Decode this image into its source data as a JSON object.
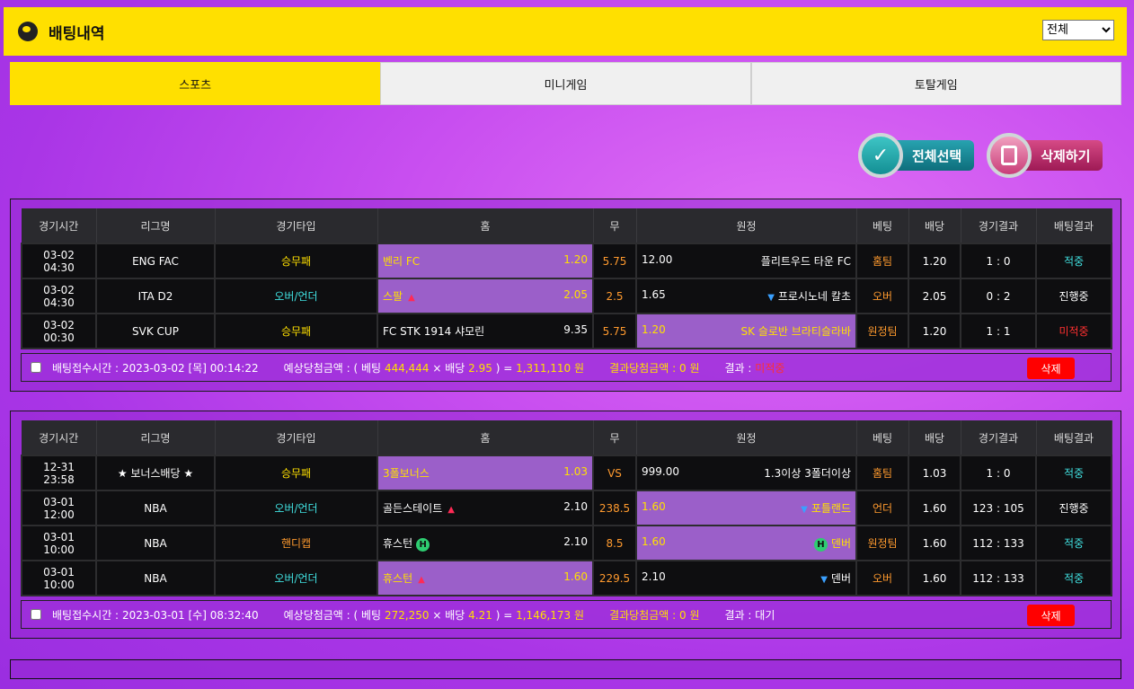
{
  "header": {
    "title": "배팅내역",
    "filter_selected": "전체",
    "filter_options": [
      "전체"
    ]
  },
  "tabs": [
    {
      "label": "스포츠"
    },
    {
      "label": "미니게임"
    },
    {
      "label": "토탈게임"
    }
  ],
  "actions": {
    "select_all": "전체선택",
    "delete": "삭제하기"
  },
  "columns": [
    "경기시간",
    "리그명",
    "경기타입",
    "홈",
    "무",
    "원정",
    "베팅",
    "배당",
    "경기결과",
    "배팅결과"
  ],
  "bets": [
    {
      "rows": [
        {
          "time": "03-02 04:30",
          "league": "ENG FAC",
          "type": "승무패",
          "home": "벤리 FC",
          "home_odds": "1.20",
          "draw": "5.75",
          "away_odds": "12.00",
          "away": "플리트우드 타운 FC",
          "pick": "홈팀",
          "odds": "1.20",
          "score": "1 : 0",
          "result": "적중"
        },
        {
          "time": "03-02 04:30",
          "league": "ITA D2",
          "type": "오버/언더",
          "home": "스팔",
          "home_odds": "2.05",
          "draw": "2.5",
          "away_odds": "1.65",
          "away": "프로시노네 칼초",
          "pick": "오버",
          "odds": "2.05",
          "score": "0 : 2",
          "result": "진행중"
        },
        {
          "time": "03-02 00:30",
          "league": "SVK CUP",
          "type": "승무패",
          "home": "FC STK 1914 샤모린",
          "home_odds": "9.35",
          "draw": "5.75",
          "away_odds": "1.20",
          "away": "SK 슬로반 브라티슬라바",
          "pick": "원정팀",
          "odds": "1.20",
          "score": "1 : 1",
          "result": "미적중"
        }
      ],
      "summary": {
        "accept_label": "배팅접수시간 :",
        "accept_time": "2023-03-02 [목] 00:14:22",
        "expected_label": "예상당첨금액 : ( 베팅",
        "bet_amount": "444,444",
        "mult": "× 배당",
        "bet_odds": "2.95",
        "eq": ") =",
        "payout": "1,311,110",
        "won": "원",
        "won_label": "결과당첨금액 :",
        "won_amount": "0",
        "won_unit": "원",
        "result_label": "결과 :",
        "result": "미적중",
        "delete": "삭제"
      }
    },
    {
      "rows": [
        {
          "time": "12-31 23:58",
          "league": "★ 보너스배당 ★",
          "type": "승무패",
          "home": "3폴보너스",
          "home_odds": "1.03",
          "draw": "VS",
          "away_odds": "999.00",
          "away": "1.3이상 3폴더이상",
          "pick": "홈팀",
          "odds": "1.03",
          "score": "1 : 0",
          "result": "적중"
        },
        {
          "time": "03-01 12:00",
          "league": "NBA",
          "type": "오버/언더",
          "home": "골든스테이트",
          "home_odds": "2.10",
          "draw": "238.5",
          "away_odds": "1.60",
          "away": "포틀랜드",
          "pick": "언더",
          "odds": "1.60",
          "score": "123 : 105",
          "result": "진행중"
        },
        {
          "time": "03-01 10:00",
          "league": "NBA",
          "type": "핸디캡",
          "home": "휴스턴",
          "home_odds": "2.10",
          "draw": "8.5",
          "away_odds": "1.60",
          "away": "덴버",
          "pick": "원정팀",
          "odds": "1.60",
          "score": "112 : 133",
          "result": "적중"
        },
        {
          "time": "03-01 10:00",
          "league": "NBA",
          "type": "오버/언더",
          "home": "휴스턴",
          "home_odds": "1.60",
          "draw": "229.5",
          "away_odds": "2.10",
          "away": "덴버",
          "pick": "오버",
          "odds": "1.60",
          "score": "112 : 133",
          "result": "적중"
        }
      ],
      "summary": {
        "accept_label": "배팅접수시간 :",
        "accept_time": "2023-03-01 [수] 08:32:40",
        "expected_label": "예상당첨금액 : ( 베팅",
        "bet_amount": "272,250",
        "mult": "× 배당",
        "bet_odds": "4.21",
        "eq": ") =",
        "payout": "1,146,173",
        "won": "원",
        "won_label": "결과당첨금액 :",
        "won_amount": "0",
        "won_unit": "원",
        "result_label": "결과 :",
        "result": "대기",
        "delete": "삭제"
      }
    }
  ],
  "icons": {
    "handicap": "H",
    "up_arrow": "up-triangle",
    "down_arrow": "down-triangle"
  }
}
